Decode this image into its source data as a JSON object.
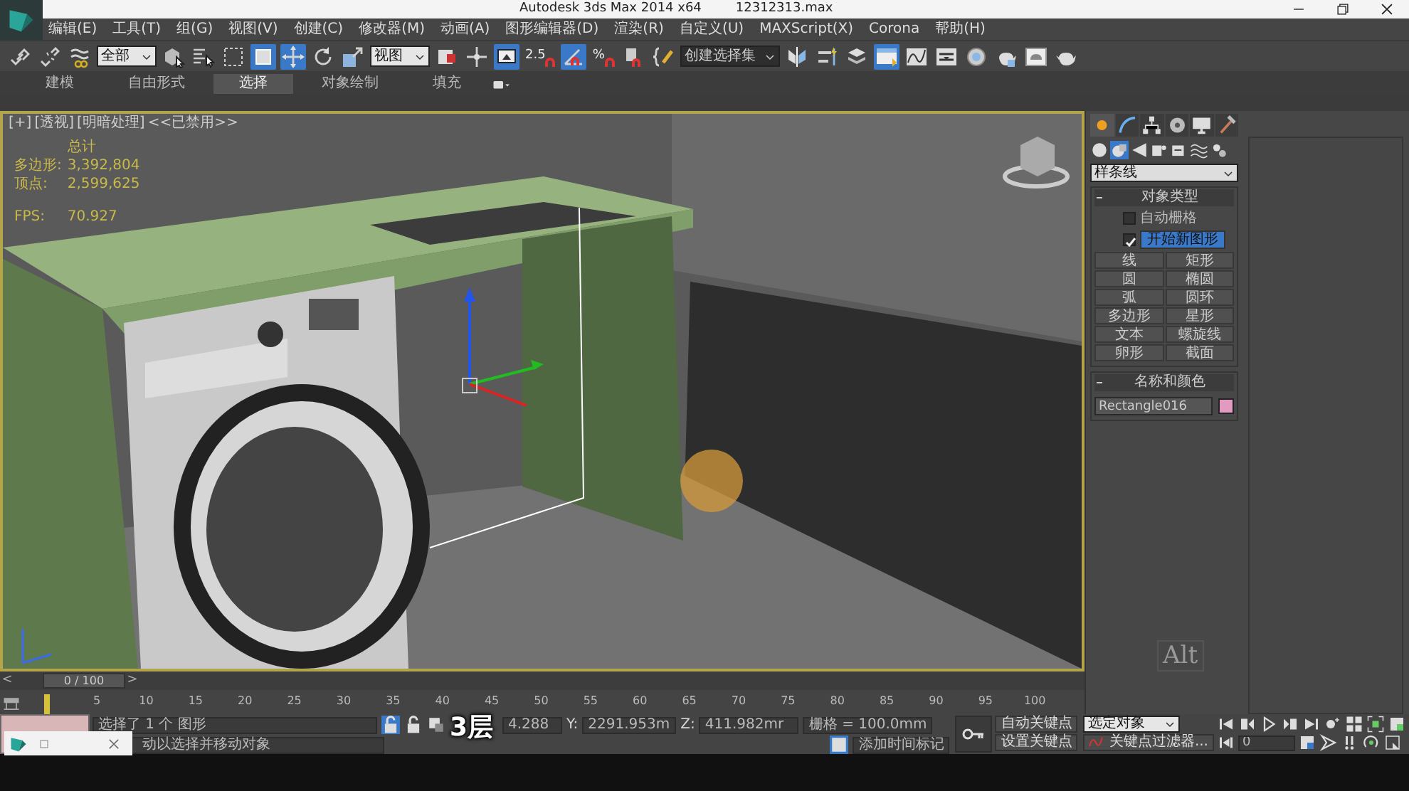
{
  "title_bar": {
    "app_name": "Autodesk 3ds Max  2014 x64",
    "file_name": "12312313.max"
  },
  "menu": [
    "编辑(E)",
    "工具(T)",
    "组(G)",
    "视图(V)",
    "创建(C)",
    "修改器(M)",
    "动画(A)",
    "图形编辑器(D)",
    "渲染(R)",
    "自定义(U)",
    "MAXScript(X)",
    "Corona",
    "帮助(H)"
  ],
  "toolbar": [
    {
      "kind": "icon",
      "selected": false
    },
    {
      "kind": "icon",
      "selected": false
    },
    {
      "kind": "icon",
      "selected": false
    },
    {
      "kind": "dropdown",
      "value": "全部"
    },
    {
      "kind": "icon",
      "selected": false
    },
    {
      "kind": "icon",
      "selected": false
    },
    {
      "kind": "icon",
      "selected": false
    },
    {
      "kind": "icon",
      "selected": true
    },
    {
      "kind": "icon",
      "selected": true
    },
    {
      "kind": "icon",
      "selected": false
    },
    {
      "kind": "icon",
      "selected": false
    },
    {
      "kind": "dropdown",
      "value": "视图"
    },
    {
      "kind": "icon",
      "selected": false
    },
    {
      "kind": "icon",
      "selected": false
    },
    {
      "kind": "icon",
      "selected": true
    },
    {
      "kind": "snap",
      "label": "2.5",
      "selected": false
    },
    {
      "kind": "icon",
      "selected": true
    },
    {
      "kind": "snap",
      "label": "%",
      "selected": false
    },
    {
      "kind": "icon",
      "selected": false
    },
    {
      "kind": "icon",
      "selected": false
    },
    {
      "kind": "dropdown",
      "value": "创建选择集"
    },
    {
      "kind": "icon",
      "selected": false
    },
    {
      "kind": "icon",
      "selected": false
    },
    {
      "kind": "icon",
      "selected": false
    },
    {
      "kind": "icon",
      "selected": true
    },
    {
      "kind": "icon",
      "selected": false
    },
    {
      "kind": "icon",
      "selected": false
    },
    {
      "kind": "icon",
      "selected": false
    },
    {
      "kind": "icon",
      "selected": false
    },
    {
      "kind": "icon",
      "selected": false
    },
    {
      "kind": "icon",
      "selected": false
    }
  ],
  "ribbon_tabs": [
    {
      "label": "建模",
      "selected": false
    },
    {
      "label": "自由形式",
      "selected": false
    },
    {
      "label": "选择",
      "selected": true
    },
    {
      "label": "对象绘制",
      "selected": false
    },
    {
      "label": "填充",
      "selected": false
    }
  ],
  "viewport": {
    "labels": [
      "[+]",
      "[透视]",
      "[明暗处理]",
      "<<已禁用>>"
    ],
    "stats": {
      "heading": "总计",
      "rows": [
        {
          "label": "多边形:",
          "value": "3,392,804"
        },
        {
          "label": "顶点:",
          "value": "2,599,625"
        }
      ],
      "fps_label": "FPS:",
      "fps_value": "70.927"
    }
  },
  "key_overlay": "Alt",
  "command_panel": {
    "tabs": [
      {
        "selected": true
      },
      {
        "selected": false
      },
      {
        "selected": false
      },
      {
        "selected": false
      },
      {
        "selected": false
      },
      {
        "selected": false
      }
    ],
    "categories": [
      {
        "selected": false
      },
      {
        "selected": true
      },
      {
        "selected": false
      },
      {
        "selected": false
      },
      {
        "selected": false
      },
      {
        "selected": false
      },
      {
        "selected": false
      }
    ],
    "dropdown": "样条线",
    "object_type": {
      "title": "对象类型",
      "auto_grid": {
        "label": "自动栅格",
        "checked": false
      },
      "start_new_shape": {
        "label": "开始新图形",
        "checked": true
      },
      "buttons": [
        "线",
        "矩形",
        "圆",
        "椭圆",
        "弧",
        "圆环",
        "多边形",
        "星形",
        "文本",
        "螺旋线",
        "卵形",
        "截面"
      ]
    },
    "name_and_color": {
      "title": "名称和颜色",
      "name": "Rectangle016",
      "color": "#e39ac0"
    }
  },
  "time_slider": {
    "prev": "<",
    "position": "0 / 100",
    "next": ">"
  },
  "track_bar": {
    "ticks": [
      "5",
      "10",
      "15",
      "20",
      "25",
      "30",
      "35",
      "40",
      "45",
      "50",
      "55",
      "60",
      "65",
      "70",
      "75",
      "80",
      "85",
      "90",
      "95",
      "100"
    ]
  },
  "status_bar": {
    "selection": "选择了 1 个 图形",
    "prompt": "动以选择并移动对象",
    "x_value": "4.288",
    "y_label": "Y:",
    "y_value": "2291.953m",
    "z_label": "Z:",
    "z_value": "411.982mr",
    "grid": "栅格 = 100.0mm",
    "add_time_tag": "添加时间标记",
    "auto_key": "自动关键点",
    "key_target": "选定对象",
    "set_key": "设置关键点",
    "key_filters": "关键点过滤器...",
    "frame": "0"
  },
  "subtitle": "3层"
}
